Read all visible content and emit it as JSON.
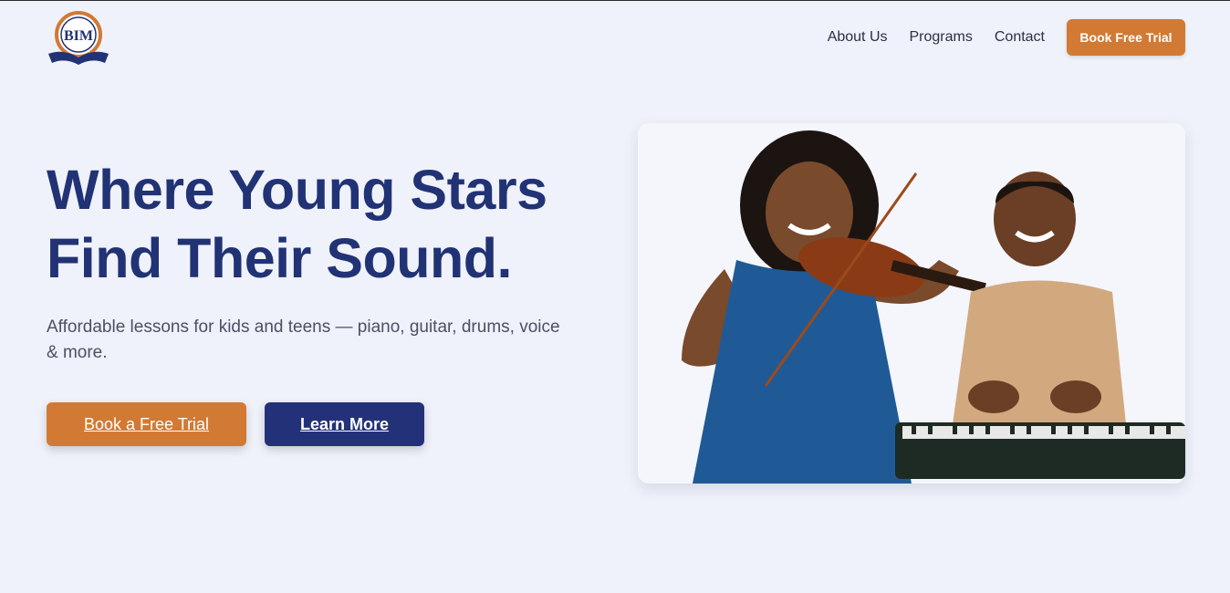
{
  "brand": {
    "logo_text": "BIM"
  },
  "nav": {
    "items": [
      {
        "label": "About Us"
      },
      {
        "label": "Programs"
      },
      {
        "label": "Contact"
      }
    ],
    "cta_label": "Book Free Trial"
  },
  "hero": {
    "headline_line1": "Where Young Stars",
    "headline_line2": "Find Their Sound.",
    "subtitle": "Affordable lessons for kids and teens — piano, guitar, drums, voice & more.",
    "primary_button": "Book a Free Trial",
    "secondary_button": "Learn More",
    "image_icon": "children-playing-violin-and-keyboard-photo"
  },
  "colors": {
    "accent": "#d27a33",
    "brand_navy": "#213275",
    "background": "#eff2fa"
  }
}
